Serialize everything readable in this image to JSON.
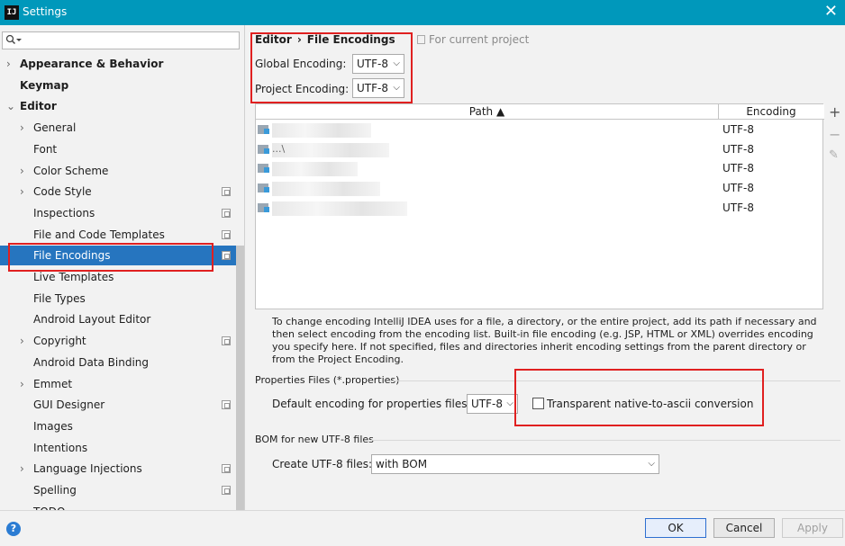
{
  "window": {
    "title": "Settings",
    "app_icon": "IJ",
    "close_icon": "close-icon"
  },
  "sidebar": {
    "search_placeholder": "",
    "items": [
      {
        "label": "Appearance & Behavior",
        "bold": true,
        "arrow": "›"
      },
      {
        "label": "Keymap",
        "bold": true,
        "arrow": ""
      },
      {
        "label": "Editor",
        "bold": true,
        "arrow": "⌄"
      },
      {
        "label": "General",
        "arrow": "›"
      },
      {
        "label": "Font",
        "arrow": ""
      },
      {
        "label": "Color Scheme",
        "arrow": "›"
      },
      {
        "label": "Code Style",
        "arrow": "›",
        "project": true
      },
      {
        "label": "Inspections",
        "arrow": "",
        "project": true
      },
      {
        "label": "File and Code Templates",
        "arrow": "",
        "project": true
      },
      {
        "label": "File Encodings",
        "arrow": "",
        "project": true,
        "selected": true
      },
      {
        "label": "Live Templates",
        "arrow": ""
      },
      {
        "label": "File Types",
        "arrow": ""
      },
      {
        "label": "Android Layout Editor",
        "arrow": ""
      },
      {
        "label": "Copyright",
        "arrow": "›",
        "project": true
      },
      {
        "label": "Android Data Binding",
        "arrow": ""
      },
      {
        "label": "Emmet",
        "arrow": "›"
      },
      {
        "label": "GUI Designer",
        "arrow": "",
        "project": true
      },
      {
        "label": "Images",
        "arrow": ""
      },
      {
        "label": "Intentions",
        "arrow": ""
      },
      {
        "label": "Language Injections",
        "arrow": "›",
        "project": true
      },
      {
        "label": "Spelling",
        "arrow": "",
        "project": true
      },
      {
        "label": "TODO",
        "arrow": ""
      }
    ]
  },
  "main": {
    "breadcrumb": {
      "parent": "Editor",
      "separator": "›",
      "current": "File Encodings"
    },
    "for_current_project": "For current project",
    "global_encoding": {
      "label": "Global Encoding:",
      "value": "UTF-8"
    },
    "project_encoding": {
      "label": "Project Encoding:",
      "value": "UTF-8"
    },
    "table": {
      "columns": [
        "Path ▲",
        "Encoding"
      ],
      "rows": [
        {
          "path": "",
          "encoding": "UTF-8"
        },
        {
          "path": "...\\",
          "encoding": "UTF-8"
        },
        {
          "path": "",
          "encoding": "UTF-8"
        },
        {
          "path": "",
          "encoding": "UTF-8"
        },
        {
          "path": "",
          "encoding": "UTF-8"
        }
      ],
      "tools": {
        "add": "+",
        "remove": "−",
        "edit": "✎"
      }
    },
    "description": "To change encoding IntelliJ IDEA uses for a file, a directory, or the entire project, add its path if necessary and then select encoding from the encoding list. Built-in file encoding (e.g. JSP, HTML or XML) overrides encoding you specify here. If not specified, files and directories inherit encoding settings from the parent directory or from the Project Encoding.",
    "properties": {
      "section_title": "Properties Files (*.properties)",
      "default_label": "Default encoding for properties files:",
      "default_value": "UTF-8",
      "transparent_label": "Transparent native-to-ascii conversion",
      "transparent_checked": false
    },
    "bom": {
      "section_title": "BOM for new UTF-8 files",
      "create_label": "Create UTF-8 files:",
      "create_value": "with BOM"
    }
  },
  "footer": {
    "help": "?",
    "ok": "OK",
    "cancel": "Cancel",
    "apply": "Apply"
  },
  "colors": {
    "titlebar": "#0098bb",
    "selection": "#2675bf",
    "highlight_box": "#e02020"
  }
}
